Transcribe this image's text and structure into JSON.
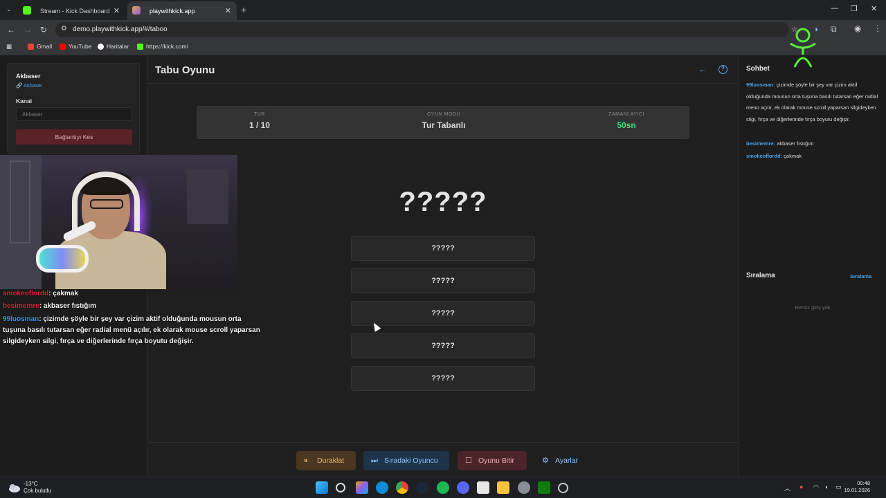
{
  "browser": {
    "tabs": [
      {
        "label": "Stream - Kick Dashboard"
      },
      {
        "label": "playwithkick.app"
      }
    ],
    "url": "demo.playwithkick.app/#/taboo",
    "bookmarks": [
      "Gmail",
      "YouTube",
      "Haritalar",
      "https://kick.com/"
    ]
  },
  "connection": {
    "name": "Akbaser",
    "link": "Akbaser",
    "channel_label": "Kanal",
    "channel_placeholder": "Akbaser",
    "disconnect_label": "Bağlantıyı Kes"
  },
  "overlay_chat": [
    {
      "user": "smokeoflordd",
      "text": ": çakmak",
      "color": "#e0203a"
    },
    {
      "user": "besimemre",
      "text": ": akbaser fıstığım",
      "color": "#e0203a"
    },
    {
      "user": "99luosman",
      "text": ": çizimde şöyle bir şey var çizim aktif olduğunda mousun orta tuşuna basılı tutarsan eğer radial menü açılır, ek olarak mouse scroll yaparsan silgideyken silgi, fırça ve diğerlerinde fırça boyutu değişir.",
      "color": "#3f8df2"
    }
  ],
  "game": {
    "title": "Tabu Oyunu",
    "stats": {
      "round_label": "TUR",
      "round_value": "1 / 10",
      "mode_label": "OYUN MODU",
      "mode_value": "Tur Tabanlı",
      "timer_label": "ZAMANLAYICI",
      "timer_value": "50sn"
    },
    "hidden_word": "?????",
    "taboo_words": [
      "?????",
      "?????",
      "?????",
      "?????",
      "?????"
    ],
    "buttons": {
      "pause": "Duraklat",
      "next_player": "Sıradaki Oyuncu",
      "end_game": "Oyunu Bitir",
      "settings": "Ayarlar"
    }
  },
  "chat": {
    "title": "Sohbet",
    "messages": [
      {
        "user": "99luosman:",
        "text": " çizimde şöyle bir şey var çizim aktif olduğunda mousun orta tuşuna basılı tutarsan eğer radial menü açılır, ek olarak mouse scroll yaparsan silgideyken silgi, fırça ve diğerlerinde fırça boyutu değişir."
      },
      {
        "user": "besimemre:",
        "text": " akbaser fıstığım"
      },
      {
        "user": "smokeoflordd:",
        "text": " çakmak"
      }
    ]
  },
  "ranking": {
    "title": "Sıralama",
    "link": "Sıralama",
    "empty": "Henüz giriş yok"
  },
  "taskbar": {
    "temp": "-13°C",
    "weather": "Çok bulutlu",
    "time": "00:48",
    "date": "19.01.2026"
  },
  "colors": {
    "accent_blue": "#4aa3e8",
    "timer_green": "#3fdc7a",
    "pause_bg": "#4a3621",
    "end_bg": "#4a2429",
    "next_bg": "#1d3349"
  }
}
